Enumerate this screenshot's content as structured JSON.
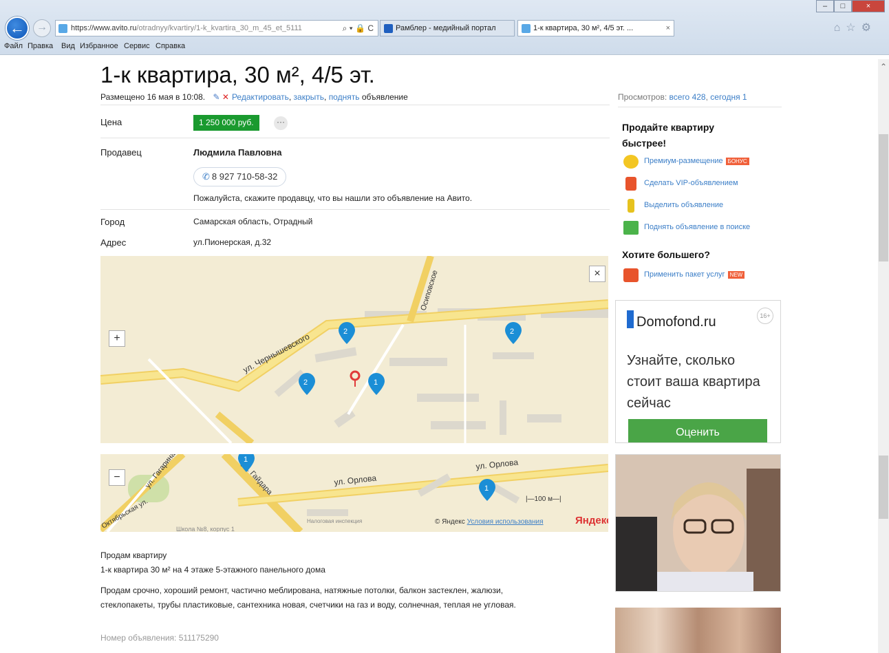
{
  "browser": {
    "address_scheme": "https://www.",
    "address_host": "avito.ru",
    "address_path": "/otradnyy/kvartiry/1-k_kvartira_30_m_45_et_5111",
    "address_ctrls": "⌕ ▾ 🔒 C",
    "tabs": [
      {
        "label": "Рамблер - медийный портал",
        "active": false
      },
      {
        "label": "1-к квартира, 30 м², 4/5 эт. ...",
        "active": true
      }
    ],
    "close_glyph": "×",
    "toolbar_icons": "⌂☆⚙",
    "menu": [
      "Файл",
      "Правка",
      "Вид",
      "Избранное",
      "Сервис",
      "Справка"
    ]
  },
  "listing": {
    "title": "1-к квартира, 30 м², 4/5 эт.",
    "posted": "Размещено 16 мая в 10:08.",
    "edit": "Редактировать",
    "close": "закрыть",
    "raise": "поднять",
    "ad_word": "объявление",
    "views_label": "Просмотров:",
    "views_total": "всего 428",
    "views_today": "сегодня 1",
    "price_label": "Цена",
    "price": "1 250 000 руб.",
    "more": "···",
    "seller_label": "Продавец",
    "seller": "Людмила Павловна",
    "phone": "8 927 710-58-32",
    "phone_note": "Пожалуйста, скажите продавцу, что вы нашли это объявление на Авито.",
    "city_label": "Город",
    "city": "Самарская область, Отрадный",
    "address_label": "Адрес",
    "address": "ул.Пионерская, д.32",
    "desc_title": "Продам квартиру",
    "desc_sub": "1-к квартира 30 м² на 4 этаже 5-этажного панельного дома",
    "desc_line1": "Продам срочно, хороший ремонт, частично меблирована, натяжные потолки, балкон застеклен, жалюзи,",
    "desc_line2": "стеклопакеты, трубы пластиковые, сантехника новая, счетчики на газ и воду, солнечная, теплая не угловая.",
    "ad_number": "Номер объявления: 511175290"
  },
  "map": {
    "streets": [
      "ул. Чернышевского",
      "Осиповское",
      "ул. Орлова",
      "ул. Орлова",
      "ул. Гагарина",
      "ул. Гайдара",
      "Октябрьская ул.",
      "Школа №8, корпус 1",
      "Налоговая инспекция"
    ],
    "markers": [
      "2",
      "2",
      "2",
      "1",
      "1",
      "1"
    ],
    "scale": "100 м",
    "copyright": "© Яндекс",
    "terms": "Условия использования",
    "brand": "Яндекс",
    "zoom_in": "+",
    "zoom_out": "−",
    "close": "×"
  },
  "sidebar": {
    "sell_title": "Продайте квартиру быстрее!",
    "promos": [
      {
        "label": "Премиум-размещение",
        "badge": "БОНУС",
        "color": "#f3c623"
      },
      {
        "label": "Сделать VIP-объявлением",
        "badge": "",
        "color": "#e8542c"
      },
      {
        "label": "Выделить объявление",
        "badge": "",
        "color": "#e6c21e"
      },
      {
        "label": "Поднять объявление в поиске",
        "badge": "",
        "color": "#4bb34a"
      }
    ],
    "more_title": "Хотите большего?",
    "pack": {
      "label": "Применить пакет услуг",
      "badge": "NEW",
      "color": "#e8542c"
    },
    "ad": {
      "brand": "Domofond.ru",
      "age": "16+",
      "text": "Узнайте, сколько стоит ваша квартира сейчас",
      "button": "Оценить"
    }
  },
  "colors": {
    "accent": "#3b7ec7",
    "price_bg": "#1a9a2f",
    "ad_button": "#4aa547"
  }
}
